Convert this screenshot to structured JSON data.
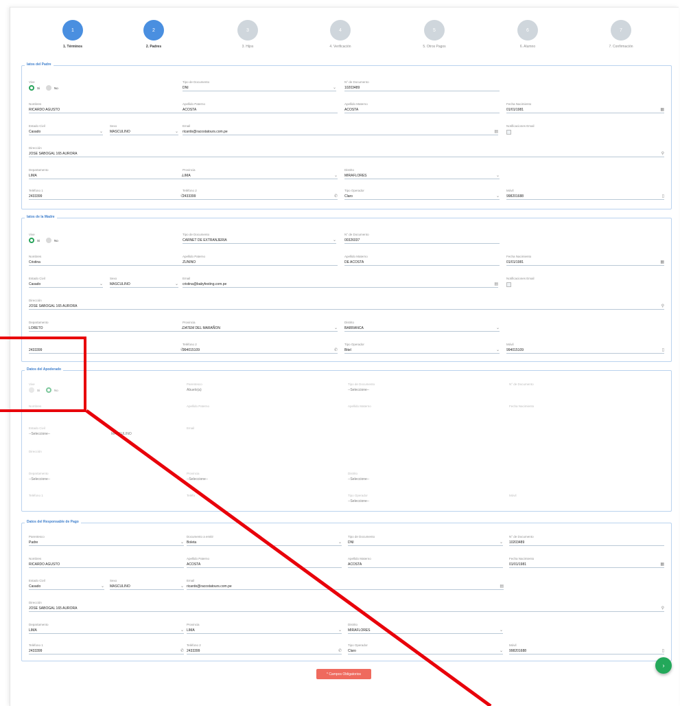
{
  "stepper": [
    {
      "num": "1",
      "label": "1. Términos",
      "active": true
    },
    {
      "num": "2",
      "label": "2. Padres",
      "active": true
    },
    {
      "num": "3",
      "label": "3. Hijos",
      "active": false
    },
    {
      "num": "4",
      "label": "4. Verificación",
      "active": false
    },
    {
      "num": "5",
      "label": "5. Otros Pagos",
      "active": false
    },
    {
      "num": "6",
      "label": "6. Alumno",
      "active": false
    },
    {
      "num": "7",
      "label": "7. Confirmación",
      "active": false
    }
  ],
  "padre": {
    "legend": "latos del Padre",
    "vive_label": "Vive",
    "si": "Si",
    "no": "No",
    "tipo_doc_label": "Tipo de Documento",
    "tipo_doc": "DNI",
    "num_doc_label": "N° de Documento",
    "num_doc": "10203489",
    "nombres_label": "Nombres",
    "nombres": "RICARDO AGUSTO",
    "ap_paterno_label": "Apellido Paterno",
    "ap_paterno": "ACOSTA",
    "ap_materno_label": "Apellido Materno",
    "ap_materno": "ACOSTA",
    "fecha_nac_label": "Fecha Nacimiento",
    "fecha_nac": "01/01/1981",
    "estado_civil_label": "Estado Civil",
    "estado_civil": "Casado",
    "sexo_label": "Sexo",
    "sexo": "MASCULINO",
    "email_label": "Email",
    "email": "ricardo@racostatours.com.pe",
    "notif_label": "Notificaciones Email",
    "direccion_label": "Dirección",
    "direccion": "JOSE SABOGAL 165 AURORA",
    "departamento_label": "Departamento",
    "departamento": "LIMA",
    "provincia_label": "Provincia",
    "provincia": "LIMA",
    "distrito_label": "Distrito",
    "distrito": "MIRAFLORES",
    "tel1_label": "Teléfono 1",
    "tel1": "2433399",
    "tel2_label": "Teléfono 2",
    "tel2": "2433399",
    "operador_label": "Tipo Operador",
    "operador": "Claro",
    "movil_label": "Móvil",
    "movil": "998201688"
  },
  "madre": {
    "legend": "latos de la Madre",
    "vive_label": "Vive",
    "si": "Si",
    "no": "No",
    "tipo_doc_label": "Tipo de Documento",
    "tipo_doc": "CARNET DE EXTRANJERIA",
    "num_doc_label": "N° de Documento",
    "num_doc": "00326037",
    "nombres_label": "Nombres",
    "nombres": "Cristina",
    "ap_paterno_label": "Apellido Paterno",
    "ap_paterno": "ZUNINO",
    "ap_materno_label": "Apellido Materno",
    "ap_materno": "DE ACOSTA",
    "fecha_nac_label": "Fecha Nacimiento",
    "fecha_nac": "01/01/1981",
    "estado_civil_label": "Estado Civil",
    "estado_civil": "Casado",
    "sexo_label": "Sexo",
    "sexo": "MASCULINO",
    "email_label": "Email",
    "email": "cristina@babyfesting.com.pe",
    "notif_label": "Notificaciones Email",
    "direccion_label": "Dirección",
    "direccion": "JOSE SABOGAL 165 AURORA",
    "departamento_label": "Departamento",
    "departamento": "LORETO",
    "provincia_label": "Provincia",
    "provincia": "DATEM DEL MARAÑON",
    "distrito_label": "Distrito",
    "distrito": "BARRANCA",
    "tel1_label": "",
    "tel1": "2433399",
    "tel2_label": "Teléfono 2",
    "tel2": "994015109",
    "operador_label": "Tipo Operador",
    "operador": "Bitel",
    "movil_label": "Móvil",
    "movil": "994015109"
  },
  "apoderado": {
    "legend": "Datos del Apoderado",
    "vive_label": "Vive",
    "si": "Si",
    "no": "No",
    "parentesco_label": "Parentesco",
    "parentesco": "Abuelo(a)",
    "tipo_doc_label": "Tipo de Documento",
    "tipo_doc": "--Seleccione--",
    "num_doc_label": "N° de Documento",
    "nombres_label": "Nombres",
    "ap_paterno_label": "Apellido Paterno",
    "ap_materno_label": "Apellido Materno",
    "fecha_nac_label": "Fecha Nacimiento",
    "estado_civil_label": "Estado Civil",
    "estado_civil": "--Seleccione--",
    "sexo": "MASCULINO",
    "email_label": "Email",
    "direccion_label": "Dirección",
    "departamento_label": "Departamento",
    "departamento": "--Seleccione--",
    "provincia_label": "Provincia",
    "provincia": "--Seleccione--",
    "distrito_label": "Distrito",
    "distrito": "--Seleccione--",
    "tel1_label": "Teléfono 1",
    "tel2_label": "Teléfo",
    "operador_label": "Tipo Operador",
    "operador": "--Seleccione--",
    "movil_label": "Móvil"
  },
  "responsable": {
    "legend": "Datos del Responsable de Pago",
    "parentesco_label": "Parentesco",
    "parentesco": "Padre",
    "doc_emitir_label": "Documento a emitir",
    "doc_emitir": "Boleta",
    "tipo_doc_label": "Tipo de Documento",
    "tipo_doc": "DNI",
    "num_doc_label": "N° de Documento",
    "num_doc": "10203489",
    "nombres_label": "Nombres",
    "nombres": "RICARDO AGUSTO",
    "ap_paterno_label": "Apellido Paterno",
    "ap_paterno": "ACOSTA",
    "ap_materno_label": "Apellido Materno",
    "ap_materno": "ACOSTA",
    "fecha_nac_label": "Fecha Nacimiento",
    "fecha_nac": "01/01/1981",
    "estado_civil_label": "Estado Civil",
    "estado_civil": "Casado",
    "sexo_label": "Sexo",
    "sexo": "MASCULINO",
    "email_label": "Email",
    "email": "ricardo@racostatours.com.pe",
    "direccion_label": "Dirección",
    "direccion": "JOSE SABOGAL 165 AURORA",
    "departamento_label": "Departamento",
    "departamento": "LIMA",
    "provincia_label": "Provincia",
    "provincia": "LIMA",
    "distrito_label": "Distrito",
    "distrito": "MIRAFLORES",
    "tel1_label": "Teléfono 1",
    "tel1": "2433399",
    "tel2_label": "Teléfono 2",
    "tel2": "2433399",
    "operador_label": "Tipo Operador",
    "operador": "Claro",
    "movil_label": "Móvil",
    "movil": "998201688"
  },
  "buttons": {
    "required": "* Campos Obligatorios",
    "next_icon": "chevron-right-icon"
  },
  "colors": {
    "primary": "#4a8fe0",
    "success": "#23a85a",
    "danger": "#ef6a5e",
    "annotation": "#e8000a"
  }
}
